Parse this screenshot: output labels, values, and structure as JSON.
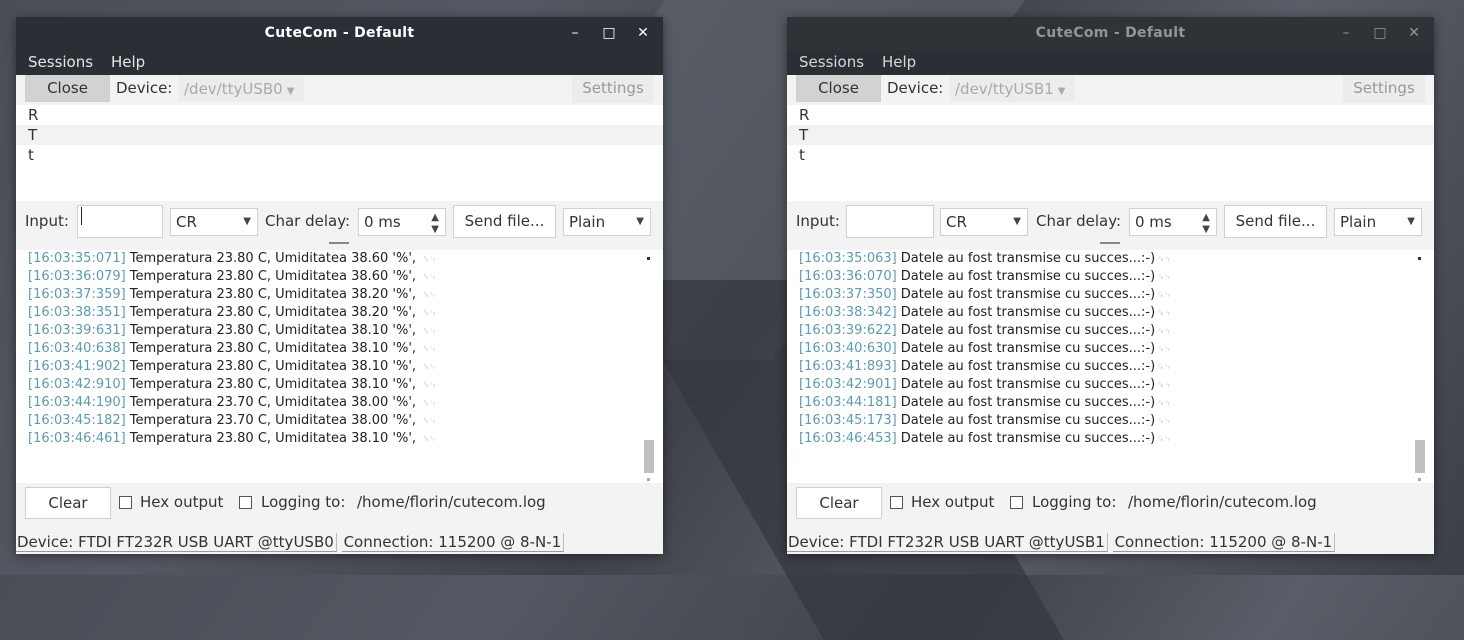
{
  "windows": [
    {
      "title": "CuteCom - Default",
      "active": true,
      "menus": {
        "sessions": "Sessions",
        "help": "Help"
      },
      "close_btn": "Close",
      "device_label": "Device:",
      "device_value": "/dev/ttyUSB0",
      "settings_btn": "Settings",
      "rtt": [
        "R",
        "T",
        "t"
      ],
      "input_label": "Input:",
      "input_value": "",
      "line_end": "CR",
      "char_delay_label": "Char delay:",
      "char_delay_value": "0 ms",
      "send_file_btn": "Send file...",
      "format": "Plain",
      "log": [
        {
          "ts": "[16:03:35:071]",
          "text": "Temperatura 23.80 C, Umiditatea 38.60 '%', "
        },
        {
          "ts": "[16:03:36:079]",
          "text": "Temperatura 23.80 C, Umiditatea 38.60 '%', "
        },
        {
          "ts": "[16:03:37:359]",
          "text": "Temperatura 23.80 C, Umiditatea 38.20 '%', "
        },
        {
          "ts": "[16:03:38:351]",
          "text": "Temperatura 23.80 C, Umiditatea 38.20 '%', "
        },
        {
          "ts": "[16:03:39:631]",
          "text": "Temperatura 23.80 C, Umiditatea 38.10 '%', "
        },
        {
          "ts": "[16:03:40:638]",
          "text": "Temperatura 23.80 C, Umiditatea 38.10 '%', "
        },
        {
          "ts": "[16:03:41:902]",
          "text": "Temperatura 23.80 C, Umiditatea 38.10 '%', "
        },
        {
          "ts": "[16:03:42:910]",
          "text": "Temperatura 23.80 C, Umiditatea 38.10 '%', "
        },
        {
          "ts": "[16:03:44:190]",
          "text": "Temperatura 23.70 C, Umiditatea 38.00 '%', "
        },
        {
          "ts": "[16:03:45:182]",
          "text": "Temperatura 23.70 C, Umiditatea 38.00 '%', "
        },
        {
          "ts": "[16:03:46:461]",
          "text": "Temperatura 23.80 C, Umiditatea 38.10 '%', "
        }
      ],
      "clear_btn": "Clear",
      "hex_output": "Hex output",
      "logging_to": "Logging to:",
      "log_path": "/home/florin/cutecom.log",
      "status_device": "Device:  FTDI FT232R USB UART @ttyUSB0",
      "status_connection": "Connection:  115200 @ 8-N-1"
    },
    {
      "title": "CuteCom - Default",
      "active": false,
      "menus": {
        "sessions": "Sessions",
        "help": "Help"
      },
      "close_btn": "Close",
      "device_label": "Device:",
      "device_value": "/dev/ttyUSB1",
      "settings_btn": "Settings",
      "rtt": [
        "R",
        "T",
        "t"
      ],
      "input_label": "Input:",
      "input_value": "",
      "line_end": "CR",
      "char_delay_label": "Char delay:",
      "char_delay_value": "0 ms",
      "send_file_btn": "Send file...",
      "format": "Plain",
      "log": [
        {
          "ts": "[16:03:35:063]",
          "text": "Datele au fost transmise cu succes...:-)"
        },
        {
          "ts": "[16:03:36:070]",
          "text": "Datele au fost transmise cu succes...:-)"
        },
        {
          "ts": "[16:03:37:350]",
          "text": "Datele au fost transmise cu succes...:-)"
        },
        {
          "ts": "[16:03:38:342]",
          "text": "Datele au fost transmise cu succes...:-)"
        },
        {
          "ts": "[16:03:39:622]",
          "text": "Datele au fost transmise cu succes...:-)"
        },
        {
          "ts": "[16:03:40:630]",
          "text": "Datele au fost transmise cu succes...:-)"
        },
        {
          "ts": "[16:03:41:893]",
          "text": "Datele au fost transmise cu succes...:-)"
        },
        {
          "ts": "[16:03:42:901]",
          "text": "Datele au fost transmise cu succes...:-)"
        },
        {
          "ts": "[16:03:44:181]",
          "text": "Datele au fost transmise cu succes...:-)"
        },
        {
          "ts": "[16:03:45:173]",
          "text": "Datele au fost transmise cu succes...:-)"
        },
        {
          "ts": "[16:03:46:453]",
          "text": "Datele au fost transmise cu succes...:-)"
        }
      ],
      "clear_btn": "Clear",
      "hex_output": "Hex output",
      "logging_to": "Logging to:",
      "log_path": "/home/florin/cutecom.log",
      "status_device": "Device:  FTDI FT232R USB UART @ttyUSB1",
      "status_connection": "Connection:  115200 @ 8-N-1"
    }
  ]
}
